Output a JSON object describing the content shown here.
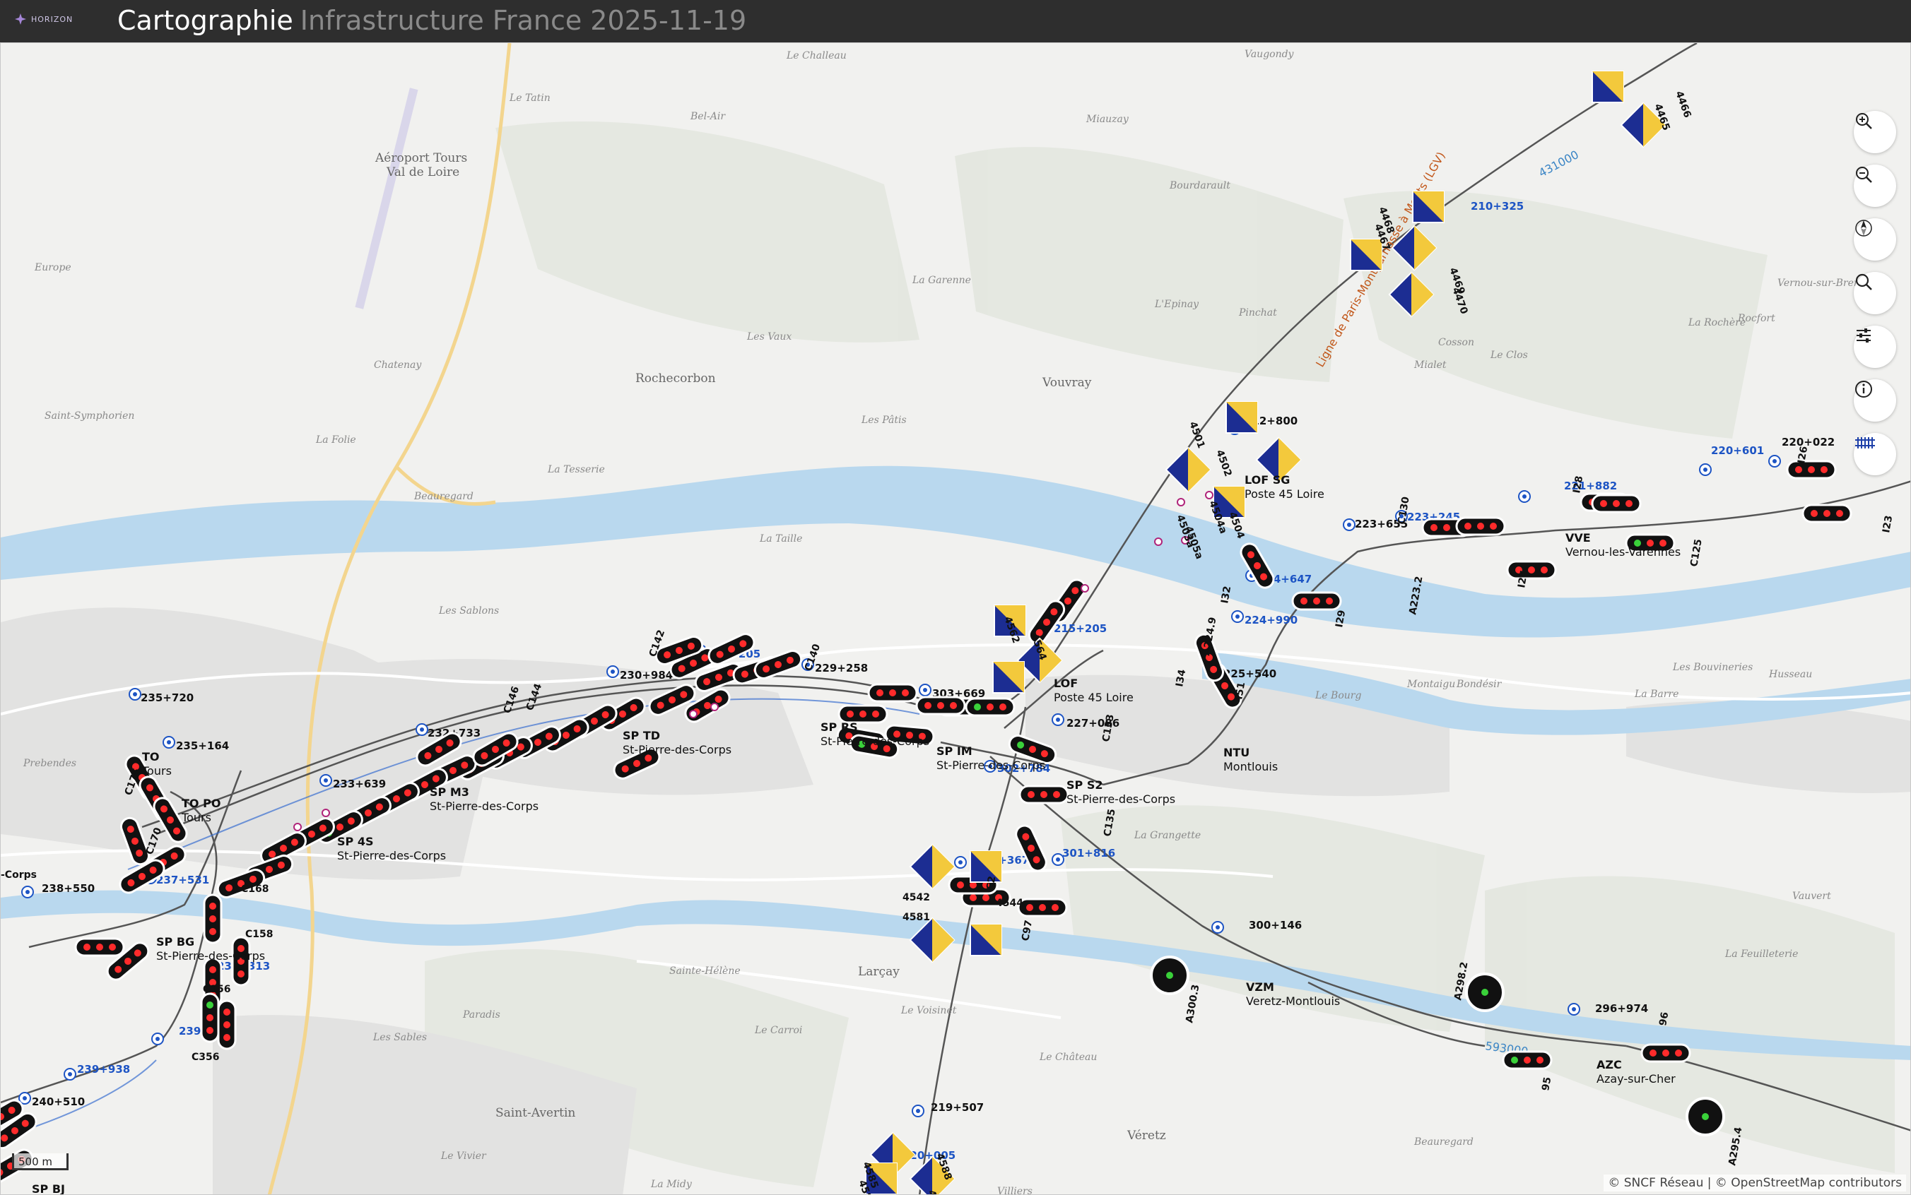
{
  "app": {
    "logo_text": "HORIZON",
    "title": "Cartographie",
    "subtitle": "Infrastructure France 2025-11-19"
  },
  "controls": [
    {
      "name": "zoom-in",
      "icon": "zoom-in-icon"
    },
    {
      "name": "zoom-out",
      "icon": "zoom-out-icon"
    },
    {
      "name": "compass",
      "icon": "compass-icon"
    },
    {
      "name": "search",
      "icon": "search-icon"
    },
    {
      "name": "filters",
      "icon": "sliders-icon"
    },
    {
      "name": "info",
      "icon": "info-icon"
    },
    {
      "name": "basemap",
      "icon": "rail-grid-icon"
    }
  ],
  "scale": "500 m",
  "attribution": "© SNCF Réseau | © OpenStreetMap contributors",
  "colors": {
    "rail": "#555555",
    "km_point": "#1d54c4",
    "river": "#b9d8ee",
    "signal_panel_yellow": "#f3c93c",
    "signal_panel_blue": "#1c2d92"
  },
  "places": [
    {
      "text": "Le Challeau"
    },
    {
      "text": "Vaugondy"
    },
    {
      "text": "Le Tatin"
    },
    {
      "text": "Bel-Air"
    },
    {
      "text": "Aéroport Tours"
    },
    {
      "text": "Val de Loire"
    },
    {
      "text": "Miauzay"
    },
    {
      "text": "Bourdarault"
    },
    {
      "text": "Europe"
    },
    {
      "text": "La Garenne"
    },
    {
      "text": "L'Epinay"
    },
    {
      "text": "Pinchat"
    },
    {
      "text": "Les Vaux"
    },
    {
      "text": "Chatenay"
    },
    {
      "text": "Rochecorbon"
    },
    {
      "text": "Vouvray"
    },
    {
      "text": "Saint-Symphorien"
    },
    {
      "text": "La Folie"
    },
    {
      "text": "Les Pâtis"
    },
    {
      "text": "Mialet"
    },
    {
      "text": "Cosson"
    },
    {
      "text": "Le Clos"
    },
    {
      "text": "Vernou-sur-Brenne"
    },
    {
      "text": "La Rochère"
    },
    {
      "text": "Rocfort"
    },
    {
      "text": "La Tesserie"
    },
    {
      "text": "Beauregard"
    },
    {
      "text": "La Taille"
    },
    {
      "text": "Les Sablons"
    },
    {
      "text": "Les Bouvineries"
    },
    {
      "text": "Husseau"
    },
    {
      "text": "Le Bourg"
    },
    {
      "text": "Montaigu"
    },
    {
      "text": "Bondésir"
    },
    {
      "text": "La Barre"
    },
    {
      "text": "Prebendes"
    },
    {
      "text": "La Grangette"
    },
    {
      "text": "Larçay"
    },
    {
      "text": "Sainte-Hélène"
    },
    {
      "text": "Le Voisinet"
    },
    {
      "text": "Paradis"
    },
    {
      "text": "Les Sables"
    },
    {
      "text": "Le Carroi"
    },
    {
      "text": "Le Château"
    },
    {
      "text": "La Feuilleterie"
    },
    {
      "text": "Saint-Avertin"
    },
    {
      "text": "Le Vivier"
    },
    {
      "text": "Véretz"
    },
    {
      "text": "Beauregard"
    },
    {
      "text": "La Midy"
    },
    {
      "text": "Villiers"
    },
    {
      "text": "Vauvert"
    }
  ],
  "km_points": [
    "235+720",
    "235+164",
    "233+639",
    "232+733",
    "230+984",
    "230+205",
    "229+258",
    "303+669",
    "302+784",
    "301+816",
    "227+086",
    "225+540",
    "224+990",
    "224+647",
    "223+655",
    "223+245",
    "221+882",
    "220+601",
    "220+022",
    "215+205",
    "212+800",
    "210+325",
    "237+531",
    "238+550",
    "238+313",
    "239+104",
    "239+938",
    "240+510",
    "217+367",
    "219+507",
    "220+005",
    "300+146",
    "296+974"
  ],
  "stations": [
    {
      "code": "TO",
      "name": "Tours"
    },
    {
      "code": "TO PO",
      "name": "Tours"
    },
    {
      "code": "SP M3",
      "name": "St-Pierre-des-Corps"
    },
    {
      "code": "SP 4S",
      "name": "St-Pierre-des-Corps"
    },
    {
      "code": "SP TD",
      "name": "St-Pierre-des-Corps"
    },
    {
      "code": "SP RS",
      "name": "St-Pierre-des-Corps"
    },
    {
      "code": "SP IM",
      "name": "St-Pierre-des-Corps"
    },
    {
      "code": "SP S2",
      "name": "St-Pierre-des-Corps"
    },
    {
      "code": "SP BG",
      "name": "St-Pierre-des-Corps"
    },
    {
      "code": "SP BJ",
      "name": "St-Pierre-des-Corps"
    },
    {
      "code": "LOF",
      "name": "Poste 45 Loire"
    },
    {
      "code": "LOF SG",
      "name": "Poste 45 Loire"
    },
    {
      "code": "NTU",
      "name": "Montlouis"
    },
    {
      "code": "VVE",
      "name": "Vernou-les-Varennes"
    },
    {
      "code": "VZM",
      "name": "Veretz-Montlouis"
    },
    {
      "code": "AZC",
      "name": "Azay-sur-Cher"
    }
  ],
  "signals": [
    "C140",
    "C142",
    "C144",
    "C146",
    "C130",
    "C125",
    "C135",
    "C133",
    "C97",
    "C156",
    "C158",
    "C168",
    "C170",
    "C175",
    "C356",
    "I28",
    "I26",
    "I27",
    "I23",
    "I32",
    "I34",
    "I51",
    "I29",
    "A223.2",
    "A224.9",
    "A298.2",
    "A300.3",
    "A295.4",
    "4542",
    "4581",
    "4544",
    "4502",
    "4501",
    "4504",
    "4503a",
    "4504a",
    "4505a",
    "4562",
    "4564",
    "4585",
    "4586",
    "4587",
    "4588",
    "4467",
    "4468",
    "4469",
    "4470",
    "4465",
    "4466",
    "95",
    "96",
    "C2",
    "-Corps"
  ],
  "line_label": "Ligne de Paris-Montparnasse à Monts (LGV)",
  "river_labels": [
    "431000",
    "593000"
  ]
}
